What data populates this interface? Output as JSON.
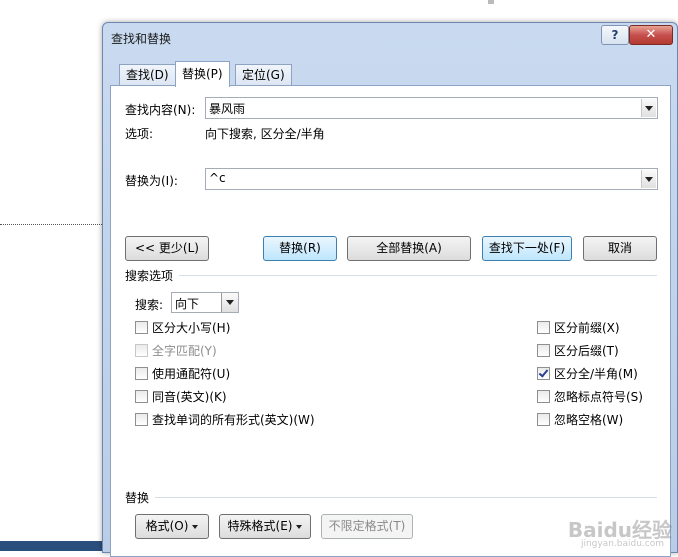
{
  "window": {
    "title": "查找和替换",
    "help_label": "?",
    "close_label": "✕"
  },
  "tabs": [
    {
      "label": "查找(D)",
      "active": false
    },
    {
      "label": "替换(P)",
      "active": true
    },
    {
      "label": "定位(G)",
      "active": false
    }
  ],
  "find": {
    "label": "查找内容(N):",
    "value": "暴风雨",
    "options_label": "选项:",
    "options_value": "向下搜索, 区分全/半角"
  },
  "replace": {
    "label": "替换为(I):",
    "value": "^c"
  },
  "buttons": {
    "less": "<< 更少(L)",
    "replace": "替换(R)",
    "replace_all": "全部替换(A)",
    "find_next": "查找下一处(F)",
    "cancel": "取消"
  },
  "search_options": {
    "section_label": "搜索选项",
    "direction_label": "搜索:",
    "direction_value": "向下"
  },
  "left_options": [
    {
      "label": "区分大小写(H)",
      "checked": false,
      "enabled": true
    },
    {
      "label": "全字匹配(Y)",
      "checked": false,
      "enabled": false
    },
    {
      "label": "使用通配符(U)",
      "checked": false,
      "enabled": true
    },
    {
      "label": "同音(英文)(K)",
      "checked": false,
      "enabled": true
    },
    {
      "label": "查找单词的所有形式(英文)(W)",
      "checked": false,
      "enabled": true
    }
  ],
  "right_options": [
    {
      "label": "区分前缀(X)",
      "checked": false,
      "enabled": true
    },
    {
      "label": "区分后缀(T)",
      "checked": false,
      "enabled": true
    },
    {
      "label": "区分全/半角(M)",
      "checked": true,
      "enabled": true
    },
    {
      "label": "忽略标点符号(S)",
      "checked": false,
      "enabled": true
    },
    {
      "label": "忽略空格(W)",
      "checked": false,
      "enabled": true
    }
  ],
  "replace_section": {
    "label": "替换",
    "format_button": "格式(O)",
    "special_button": "特殊格式(E)",
    "no_format_button": "不限定格式(T)"
  },
  "watermark": {
    "text": "Baidu经验",
    "sub": "jingyan.baidu.com"
  }
}
